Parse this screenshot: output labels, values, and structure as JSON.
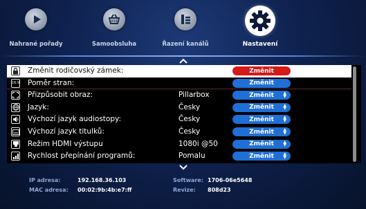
{
  "top_menu": {
    "items": [
      {
        "label": "Nahrané pořady",
        "icon": "play-icon"
      },
      {
        "label": "Samoobsluha",
        "icon": "basket-icon"
      },
      {
        "label": "Řazení kanálů",
        "icon": "channel-order-icon"
      },
      {
        "label": "Nastavení",
        "icon": "gear-icon",
        "active": true
      }
    ]
  },
  "settings": {
    "rows": [
      {
        "label": "Změnit rodičovský zámek:",
        "value": "",
        "button": "Změnit",
        "icon": "lock-icon",
        "selected": true,
        "has_arrows": false
      },
      {
        "label": "Poměr stran:",
        "value": "",
        "button": "Změnit",
        "icon": "aspect-ratio-icon",
        "icon_glyph": "16:9",
        "selected": false,
        "has_arrows": false
      },
      {
        "label": "Přizpůsobit obraz:",
        "value": "Pillarbox",
        "button": "Změnit",
        "icon": "fit-screen-icon",
        "selected": false,
        "has_arrows": true
      },
      {
        "label": "Jazyk:",
        "value": "Česky",
        "button": "Změnit",
        "icon": "globe-icon",
        "selected": false,
        "has_arrows": true
      },
      {
        "label": "Výchozí jazyk audiostopy:",
        "value": "Česky",
        "button": "Změnit",
        "icon": "speaker-icon",
        "selected": false,
        "has_arrows": true
      },
      {
        "label": "Výchozí jazyk titulků:",
        "value": "Česky",
        "button": "Změnit",
        "icon": "subtitles-icon",
        "selected": false,
        "has_arrows": true
      },
      {
        "label": "Režim HDMI výstupu",
        "value": "1080i @50",
        "button": "Změnit",
        "icon": "hdmi-icon",
        "selected": false,
        "has_arrows": true
      },
      {
        "label": "Rychlost přepínání programů:",
        "value": "Pomalu",
        "button": "Změnit",
        "icon": "signal-bars-icon",
        "selected": false,
        "has_arrows": true
      }
    ]
  },
  "footer": {
    "ip_label": "IP adresa:",
    "ip_value": "192.168.36.103",
    "mac_label": "MAC adresa:",
    "mac_value": "00:02:9b:4b:e7:ff",
    "software_label": "Software:",
    "software_value": "1706-06e5648",
    "revision_label": "Revize:",
    "revision_value": "808d23"
  },
  "colors": {
    "button_blue": "#1f6fd6",
    "button_red": "#d61919",
    "background": "#0f2250"
  }
}
